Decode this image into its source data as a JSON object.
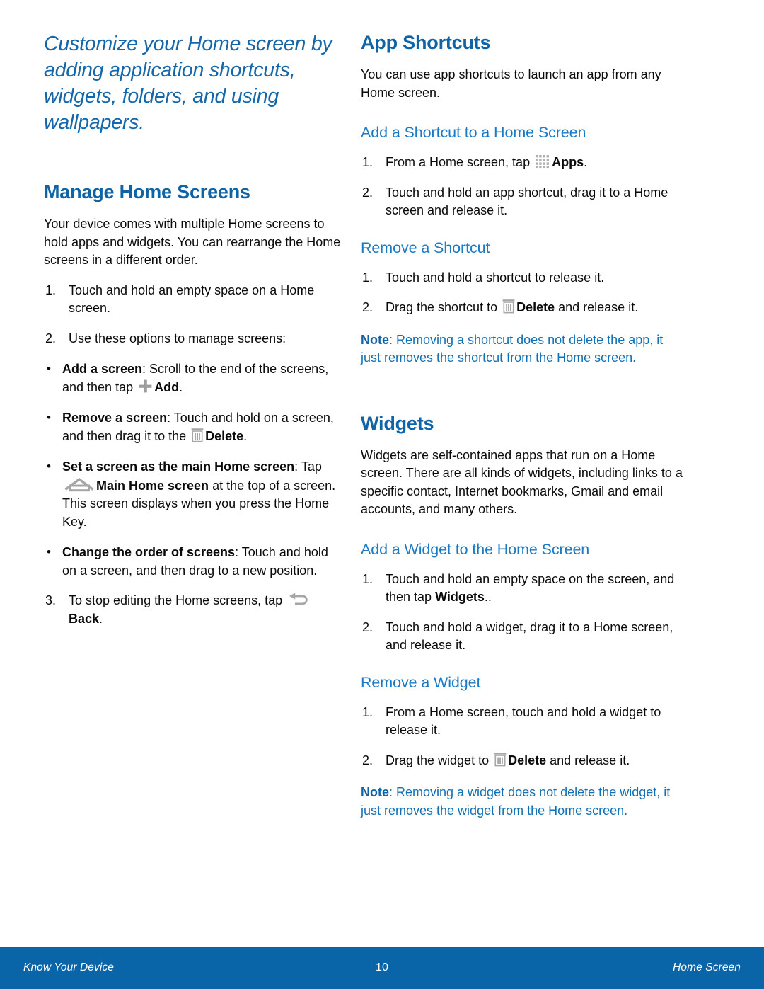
{
  "document": {
    "title": "Customize your Home screen by adding application shortcuts, widgets, folders, and using wallpapers."
  },
  "colors": {
    "heading_blue": "#0f64a8",
    "subheading_blue": "#1b7ac4",
    "note_blue": "#1270b5",
    "footer_blue": "#0a64a8",
    "body_black": "#0a0a0a",
    "icon_gray": "#9a9a9a"
  },
  "left_column": {
    "section": {
      "heading": "Manage Home Screens",
      "intro": "Your device comes with multiple Home screens to hold apps and widgets. You can rearrange the Home screens in a different order.",
      "steps": [
        {
          "num": "1.",
          "text": "Touch and hold an empty space on a Home screen."
        },
        {
          "num": "2.",
          "text": "Use these options to manage screens:"
        }
      ],
      "bullets": [
        {
          "label": "Add a screen",
          "text_before": ": Scroll to the end of the screens, and then tap ",
          "icon": "plus-icon",
          "icon_label": "Add",
          "text_after": "."
        },
        {
          "label": "Remove a screen",
          "text_before": ": Touch and hold on a screen, and then drag it to the ",
          "icon": "trash-icon",
          "icon_label": "Delete",
          "text_after": "."
        },
        {
          "label": "Set a screen as the main Home screen",
          "text_before": ": Tap ",
          "icon": "home-icon",
          "icon_label": "Main Home screen",
          "text_after": " at the top of a screen. This screen displays when you press the Home Key."
        },
        {
          "label": "Change the order of screens",
          "text_before": ": Touch and hold on a screen, and then drag to a new position.",
          "icon": "",
          "icon_label": "",
          "text_after": ""
        }
      ],
      "final_step": {
        "num": "3.",
        "text_before": "To stop editing the Home screens, tap ",
        "icon": "back-arrow-icon",
        "icon_label": "Back",
        "text_after": "."
      }
    }
  },
  "right_column": {
    "app_shortcuts": {
      "heading": "App Shortcuts",
      "intro": "You can use app shortcuts to launch an app from any Home screen.",
      "add_sub": "Add a Shortcut to a Home Screen",
      "add_steps": [
        {
          "num": "1.",
          "text_before": "From a Home screen, tap ",
          "icon": "apps-grid-icon",
          "icon_label": "Apps",
          "text_after": "."
        },
        {
          "num": "2.",
          "text_before": "Touch and hold an app shortcut, drag it to a Home screen and release it.",
          "icon": "",
          "icon_label": "",
          "text_after": ""
        }
      ],
      "remove_sub": "Remove a Shortcut",
      "remove_steps": [
        {
          "num": "1.",
          "text_before": "Touch and hold a shortcut to release it.",
          "icon": "",
          "icon_label": "",
          "text_after": ""
        },
        {
          "num": "2.",
          "text_before": "Drag the shortcut to ",
          "icon": "trash-icon",
          "icon_label": "Delete",
          "text_after": " and release it."
        }
      ],
      "note_label": "Note",
      "note_text": ": Removing a shortcut does not delete the app, it just removes the shortcut from the Home screen."
    },
    "widgets": {
      "heading": "Widgets",
      "intro": "Widgets are self-contained apps that run on a Home screen. There are all kinds of widgets, including links to a specific contact, Internet bookmarks, Gmail and email accounts, and many others.",
      "add_sub": "Add a Widget to the Home Screen",
      "add_steps": [
        {
          "num": "1.",
          "text_before": "Touch and hold an empty space on the screen, and then tap ",
          "icon": "",
          "icon_label": "Widgets",
          "text_after": ".."
        },
        {
          "num": "2.",
          "text_before": "Touch and hold a widget, drag it to a Home screen, and release it.",
          "icon": "",
          "icon_label": "",
          "text_after": ""
        }
      ],
      "remove_sub": "Remove a Widget",
      "remove_steps": [
        {
          "num": "1.",
          "text_before": "From a Home screen, touch and hold a widget to release it.",
          "icon": "",
          "icon_label": "",
          "text_after": ""
        },
        {
          "num": "2.",
          "text_before": "Drag the widget to ",
          "icon": "trash-icon",
          "icon_label": "Delete",
          "text_after": " and release it."
        }
      ],
      "note_label": "Note",
      "note_text": ": Removing a widget does not delete the widget, it just removes the widget from the Home screen."
    }
  },
  "footer": {
    "left": "Know Your Device",
    "page_number": "10",
    "right": "Home Screen"
  }
}
